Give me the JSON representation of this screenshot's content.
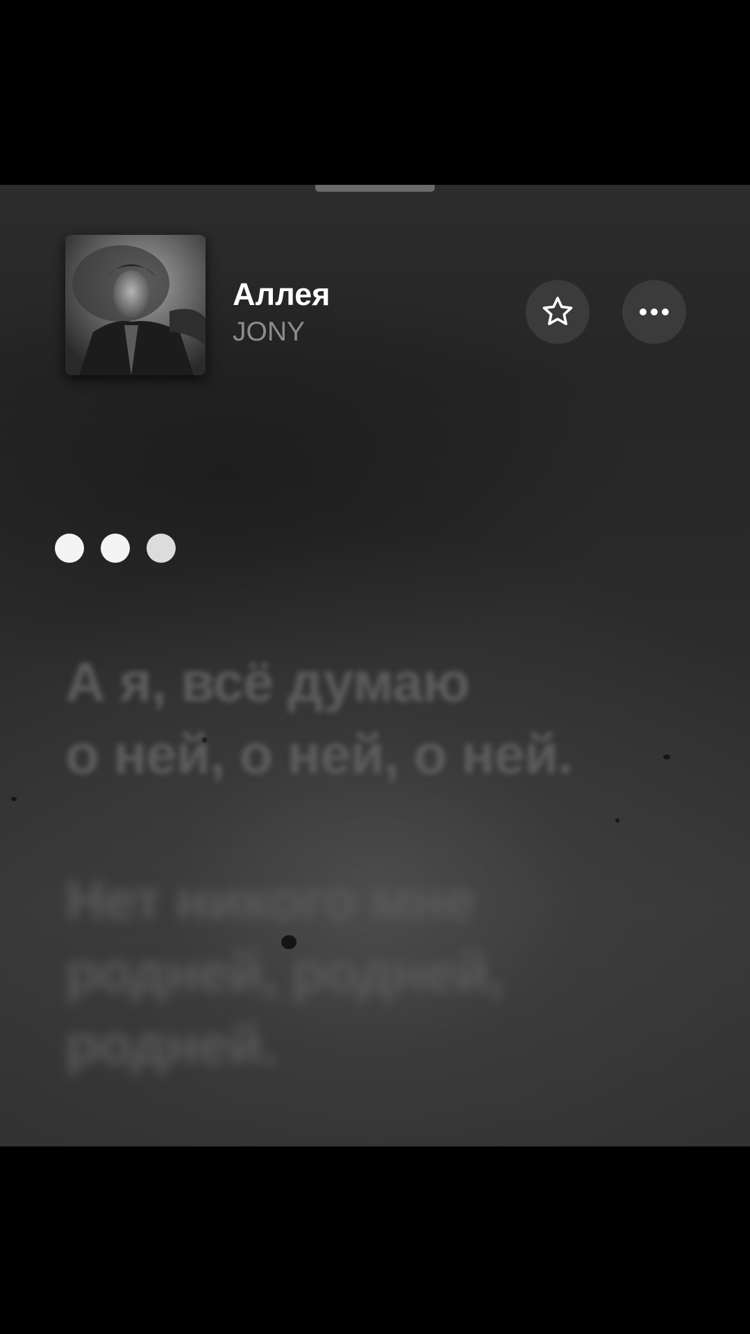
{
  "now_playing": {
    "title": "Аллея",
    "artist": "JONY",
    "artwork_icon": "album-artwork"
  },
  "actions": {
    "favorite_icon": "star-outline-icon",
    "more_icon": "ellipsis-icon"
  },
  "lyrics": {
    "interlude_indicator": "three-dots",
    "lines": [
      "А я, всё думаю\nо ней, о ней, о ней.",
      "Нет никого мне\nродней, родней,\nродней."
    ]
  },
  "colors": {
    "background_outer": "#000000",
    "sheet": "#2c2c2c",
    "title": "#ffffff",
    "artist": "#8c8c8c",
    "button_bg": "#3b3b3b"
  }
}
